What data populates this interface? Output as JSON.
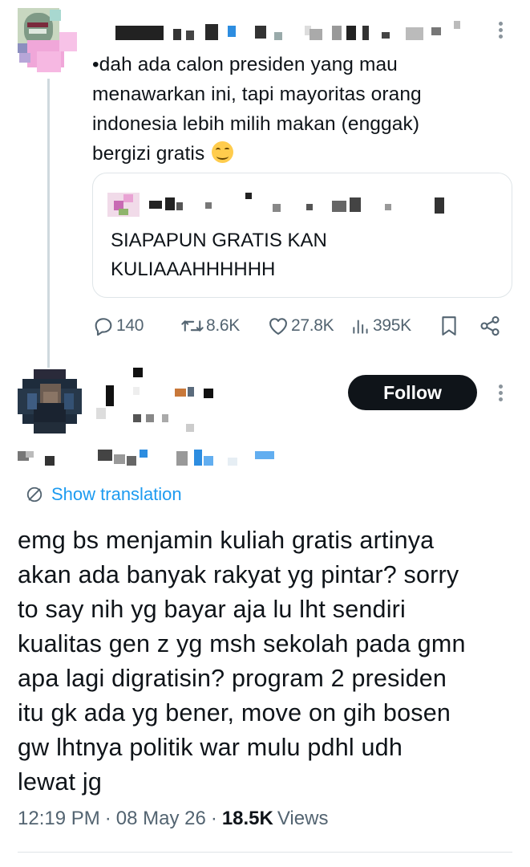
{
  "parent_tweet": {
    "text_lines": [
      "•dah ada calon presiden yang mau",
      "menawarkan ini, tapi mayoritas orang",
      "indonesia lebih milih makan (enggak)",
      "bergizi gratis"
    ],
    "quoted_tweet": {
      "text_lines": [
        "SIAPAPUN GRATIS KAN",
        "KULIAAAHHHHHH"
      ]
    },
    "stats": {
      "replies": "140",
      "reposts": "8.6K",
      "likes": "27.8K",
      "views": "395K"
    }
  },
  "reply_tweet": {
    "follow_label": "Follow",
    "show_translation_label": "Show translation",
    "text_lines": [
      "emg bs menjamin kuliah gratis artinya",
      "akan ada banyak rakyat yg pintar? sorry",
      "to say nih yg bayar aja lu lht sendiri",
      "kualitas gen z yg msh sekolah pada gmn",
      "apa lagi digratisin? program 2 presiden",
      "itu gk ada yg bener, move on gih bosen",
      "gw lhtnya politik war mulu pdhl udh",
      "lewat jg"
    ],
    "time": "12:19 PM",
    "separator": "·",
    "date": "08 May 26",
    "views_count": "18.5K",
    "views_label": "Views"
  },
  "colors": {
    "text_primary": "#0f1419",
    "text_secondary": "#536471",
    "link_blue": "#1d9bf0",
    "follow_bg": "#0f1419",
    "border": "#dfe5e8"
  },
  "icons": [
    "reply-icon",
    "repost-icon",
    "like-icon",
    "views-icon",
    "bookmark-icon",
    "share-icon",
    "translate-icon",
    "more-icon"
  ]
}
